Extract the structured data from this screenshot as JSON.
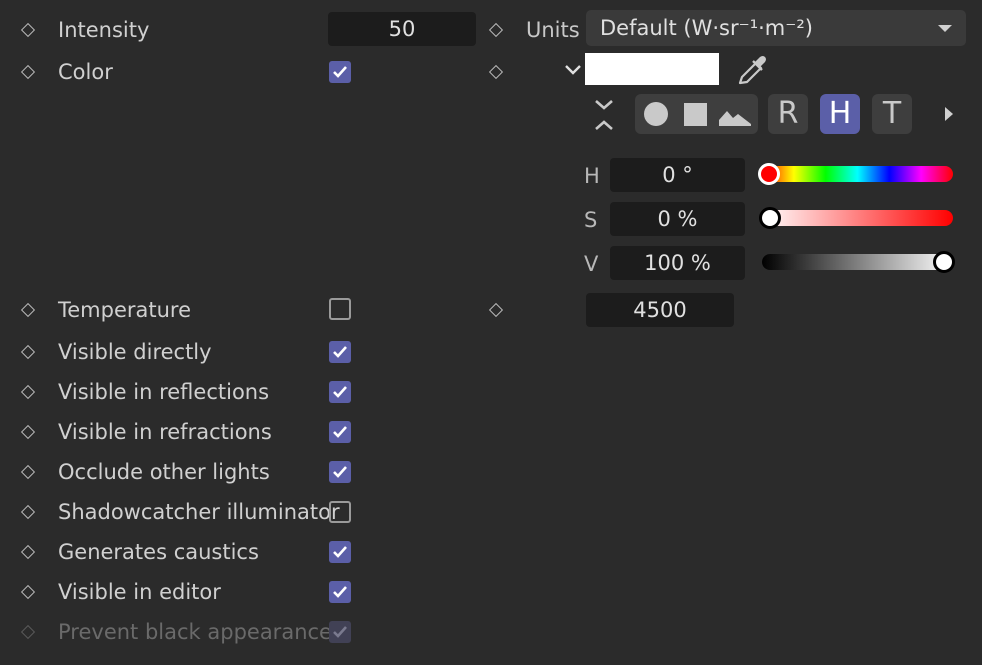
{
  "rows": {
    "intensity": {
      "label": "Intensity",
      "value": "50"
    },
    "units": {
      "label": "Units",
      "value": "Default (W·sr⁻¹·m⁻²)"
    },
    "color": {
      "label": "Color",
      "checked": true
    },
    "temperature": {
      "label": "Temperature",
      "checked": false,
      "value": "4500"
    },
    "visible_directly": {
      "label": "Visible directly",
      "checked": true
    },
    "visible_in_reflections": {
      "label": "Visible in reflections",
      "checked": true
    },
    "visible_in_refractions": {
      "label": "Visible in refractions",
      "checked": true
    },
    "occlude_other_lights": {
      "label": "Occlude other lights",
      "checked": true
    },
    "shadowcatcher_illuminator": {
      "label": "Shadowcatcher illuminator",
      "checked": false
    },
    "generates_caustics": {
      "label": "Generates caustics",
      "checked": true
    },
    "visible_in_editor": {
      "label": "Visible in editor",
      "checked": true
    },
    "prevent_black_appearance": {
      "label": "Prevent black appearance",
      "checked": true,
      "disabled": true
    }
  },
  "color_picker": {
    "swatch_color": "#ffffff",
    "mode_buttons": {
      "r": "R",
      "h": "H",
      "t": "T"
    },
    "active_mode": "H",
    "icons": [
      "collapse-expand-icon",
      "wheel-icon",
      "square-icon",
      "image-icon",
      "eyedropper-icon",
      "chevron-down-icon",
      "triangle-right-icon"
    ],
    "h": {
      "label": "H",
      "value": "0 °",
      "level": 0
    },
    "s": {
      "label": "S",
      "value": "0 %",
      "level": 0
    },
    "v": {
      "label": "V",
      "value": "100 %",
      "level": 1.0
    }
  },
  "colors": {
    "background": "#2b2b2b",
    "field": "#1c1c1c",
    "accent": "#5b5fa8",
    "checkbox_dim": "#414155"
  }
}
